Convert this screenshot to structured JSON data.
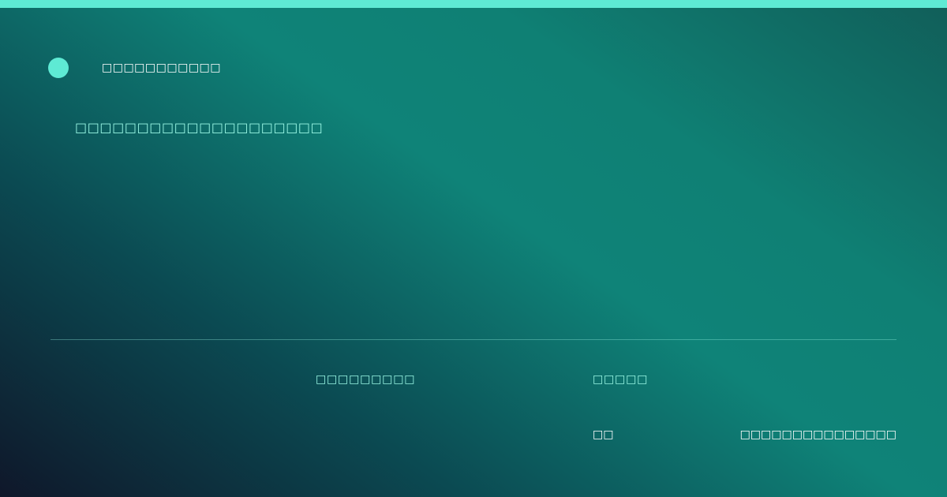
{
  "header": {
    "brand_title": "□□□□□□□□□□□",
    "subtitle": "□□□□□□□□□□□□□□□□□□□□"
  },
  "meta": {
    "label_a": "□□□□□□□□□",
    "label_b": "□□□□□"
  },
  "footer": {
    "left_text": "□□",
    "right_text": "□□□□□□□□□□□□□□□"
  },
  "colors": {
    "accent": "#5eead4",
    "accent_text": "#99f6e4",
    "background_start": "#0f172a",
    "background_mid": "#0f8378",
    "background_end": "#115e59",
    "text": "#ffffff"
  }
}
